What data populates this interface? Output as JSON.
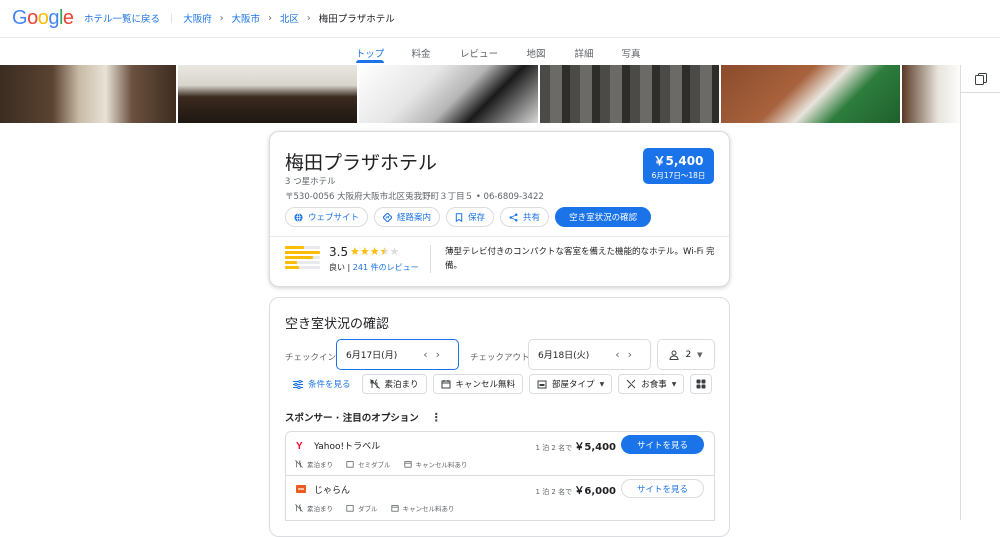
{
  "header": {
    "breadcrumbs": [
      "ホテル一覧に戻る",
      "大阪府",
      "大阪市",
      "北区",
      "梅田プラザホテル"
    ]
  },
  "tabs": [
    "トップ",
    "料金",
    "レビュー",
    "地図",
    "詳細",
    "写真"
  ],
  "hotel": {
    "name": "梅田プラザホテル",
    "class": "3 つ星ホテル",
    "address": "〒530-0056 大阪府大阪市北区兎我野町３丁目５ • 06-6809-3422",
    "price": "￥5,400",
    "dates": "6月17日〜18日",
    "actions": {
      "website": "ウェブサイト",
      "directions": "経路案内",
      "save": "保存",
      "share": "共有",
      "availability": "空き室状況の確認"
    },
    "rating": "3.5",
    "rating_stars": 3.5,
    "rating_word": "良い",
    "reviews": "241 件のレビュー",
    "description": "薄型テレビ付きのコンパクトな客室を備えた機能的なホテル。Wi-Fi 完備。"
  },
  "availability": {
    "title": "空き室状況の確認",
    "checkin_label": "チェックイン",
    "checkin": "6月17日(月)",
    "checkout_label": "チェックアウト",
    "checkout": "6月18日(火)",
    "guests": "2",
    "filters": {
      "conditions": "条件を見る",
      "room_only": "素泊まり",
      "free_cancel": "キャンセル無料",
      "room_type": "部屋タイプ",
      "meals": "お食事"
    },
    "sponsor_label": "スポンサー · 注目のオプション",
    "offers": [
      {
        "provider": "Yahoo!トラベル",
        "price_prefix": "1 泊 2 名で",
        "price": "￥5,400",
        "button": "サイトを見る",
        "features": [
          "素泊まり",
          "セミダブル",
          "キャンセル料あり"
        ]
      },
      {
        "provider": "じゃらん",
        "price_prefix": "1 泊 2 名で",
        "price": "￥6,000",
        "button": "サイトを見る",
        "features": [
          "素泊まり",
          "ダブル",
          "キャンセル料あり"
        ]
      }
    ]
  },
  "colors": {
    "accent": "#1a73e8",
    "star": "#fbbc04",
    "yahoo": "#ff0033",
    "jalan": "#eb5a1e"
  }
}
